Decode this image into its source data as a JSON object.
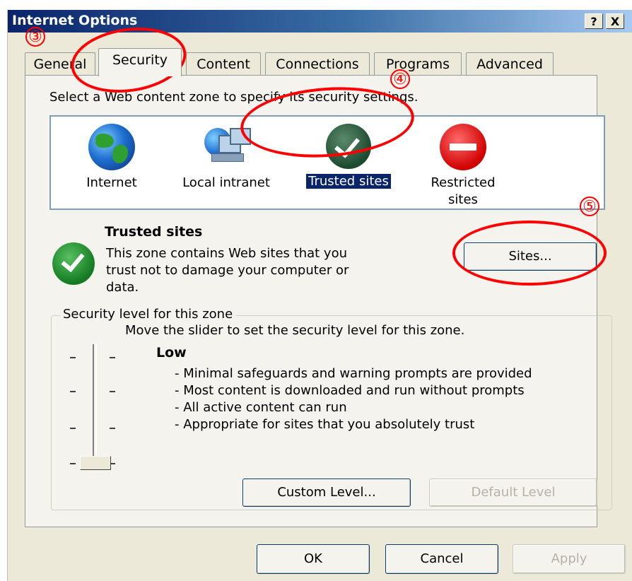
{
  "window": {
    "title": "Internet Options",
    "help_button": "?",
    "close_button": "X"
  },
  "tabs": [
    {
      "label": "General",
      "active": false
    },
    {
      "label": "Security",
      "active": true
    },
    {
      "label": "Content",
      "active": false
    },
    {
      "label": "Connections",
      "active": false
    },
    {
      "label": "Programs",
      "active": false
    },
    {
      "label": "Advanced",
      "active": false
    }
  ],
  "security": {
    "instruction": "Select a Web content zone to specify its security settings.",
    "zones": [
      {
        "label": "Internet",
        "icon": "globe-icon",
        "selected": false
      },
      {
        "label": "Local intranet",
        "icon": "network-computers-icon",
        "selected": false
      },
      {
        "label": "Trusted sites",
        "icon": "checkmark-icon",
        "selected": true
      },
      {
        "label": "Restricted sites",
        "icon": "no-entry-icon",
        "selected": false
      }
    ],
    "selected_zone_title": "Trusted sites",
    "selected_zone_description": "This zone contains Web sites that you trust not to damage your computer or data.",
    "sites_button": "Sites...",
    "level_group_label": "Security level for this zone",
    "slider_instruction": "Move the slider to set the security level for this zone.",
    "level_name": "Low",
    "level_points": [
      "- Minimal safeguards and warning prompts are provided",
      "- Most content is downloaded and run without prompts",
      "- All active content can run",
      "- Appropriate for sites that you absolutely trust"
    ],
    "slider_level": 0,
    "custom_level_button": "Custom Level...",
    "default_level_button": "Default Level"
  },
  "footer": {
    "ok_button": "OK",
    "cancel_button": "Cancel",
    "apply_button": "Apply"
  },
  "annotations": {
    "step3": "③",
    "step4": "④",
    "step5": "⑤",
    "color": "#ff0000"
  }
}
